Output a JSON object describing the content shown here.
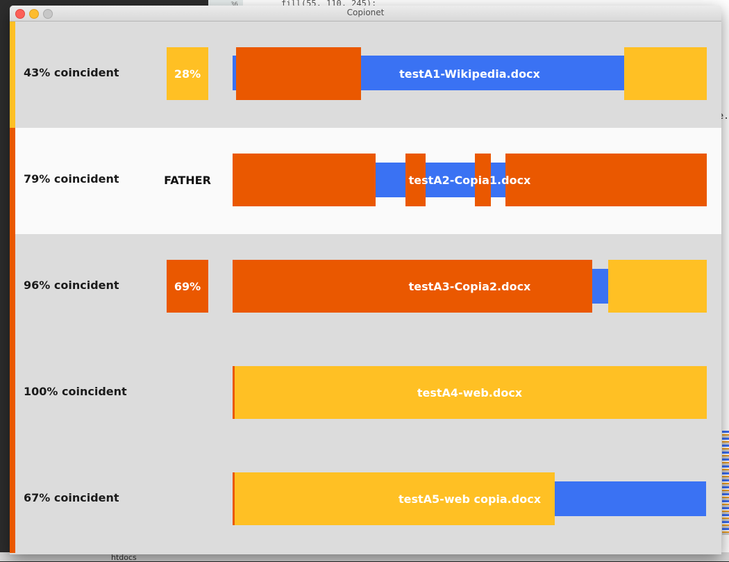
{
  "background": {
    "code_line_number": "36",
    "code_snippet": "fill(55, 110, 245);",
    "code_right_fragment": "e.",
    "folder_label": "htdocs"
  },
  "window": {
    "title": "Copionet"
  },
  "colors": {
    "orange": "#EA5800",
    "yellow": "#FFC024",
    "blue": "#3A72F3",
    "row_bg": "#DCDCDC",
    "row_bg_highlight": "#FAFAFA"
  },
  "rows": [
    {
      "coincidence": "43% coincident",
      "badge": "28%",
      "badge_color": "yellow",
      "stripe_color": "yellow",
      "file": "testA1-Wikipedia.docx",
      "highlight": false
    },
    {
      "coincidence": "79% coincident",
      "badge": "FATHER",
      "badge_color": "none",
      "stripe_color": "orange",
      "file": "testA2-Copia1.docx",
      "highlight": true
    },
    {
      "coincidence": "96% coincident",
      "badge": "69%",
      "badge_color": "orange",
      "stripe_color": "orange",
      "file": "testA3-Copia2.docx",
      "highlight": false
    },
    {
      "coincidence": "100% coincident",
      "badge": "",
      "badge_color": "none",
      "stripe_color": "orange",
      "file": "testA4-web.docx",
      "highlight": false
    },
    {
      "coincidence": "67% coincident",
      "badge": "",
      "badge_color": "none",
      "stripe_color": "orange",
      "file": "testA5-web copia.docx",
      "highlight": false
    }
  ]
}
